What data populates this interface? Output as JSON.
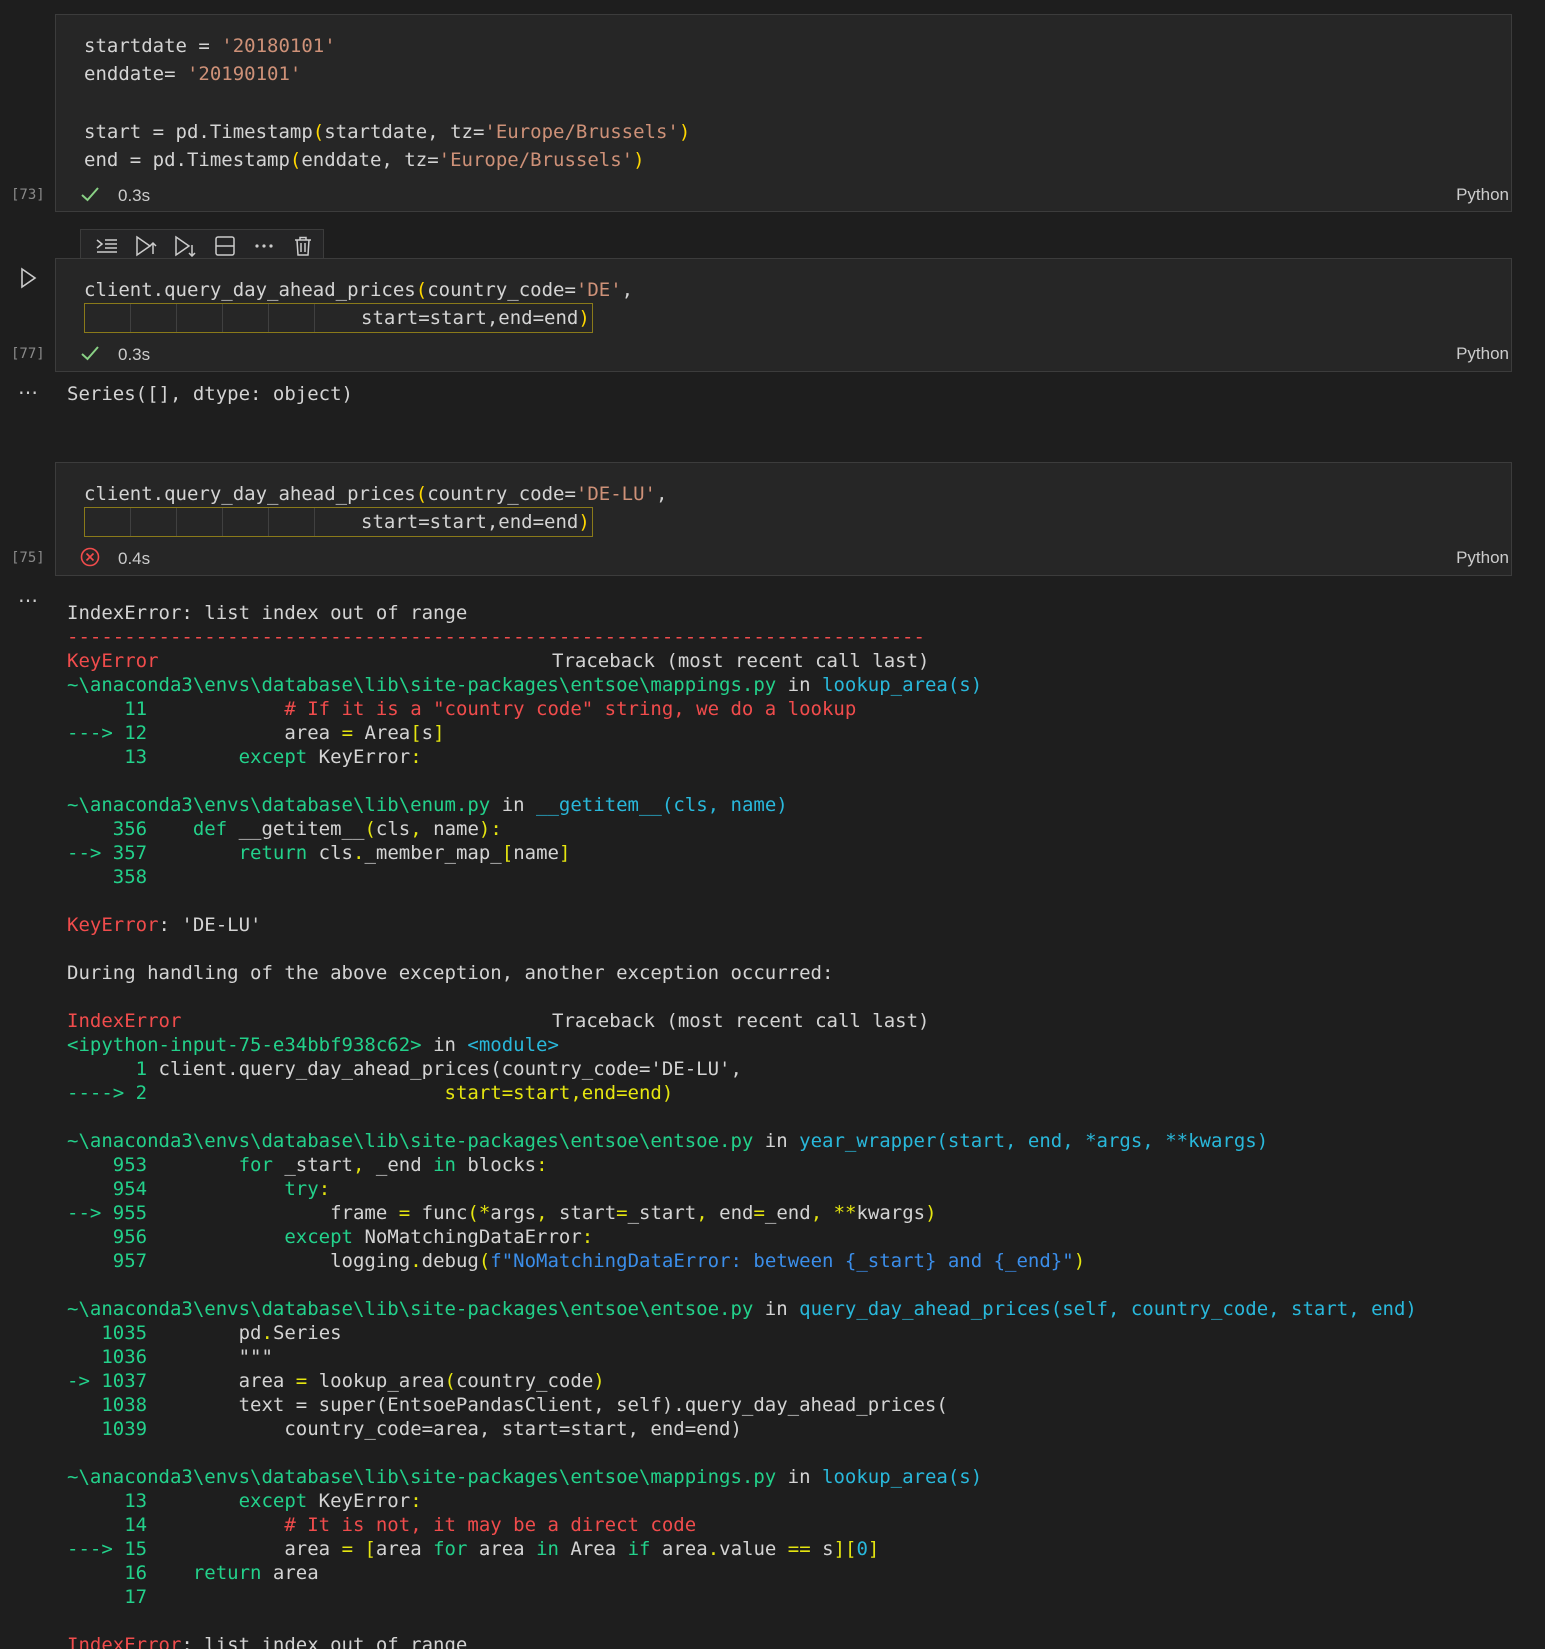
{
  "colors": {
    "background": "#1e1e1e",
    "cell_background": "#262626",
    "success_check": "#89d185",
    "error_icon": "#f14c4c",
    "string": "#ce9178",
    "bracket": "#ffd700",
    "ansi_red": "#f14c4c",
    "ansi_green": "#23d18b",
    "ansi_cyan": "#29b8db",
    "ansi_blue": "#3b8eea",
    "ansi_yellow": "#e5e510"
  },
  "toolbar": {
    "icons": [
      "execute-above-icon",
      "run-above-icon",
      "run-below-icon",
      "split-cell-icon",
      "more-actions-icon",
      "delete-cell-icon"
    ]
  },
  "cells": [
    {
      "exec_count": "[73]",
      "status": "success",
      "time": "0.3s",
      "language": "Python",
      "lines": [
        {
          "a": "startdate = ",
          "s": "'20180101'"
        },
        {
          "a": "enddate= ",
          "s": "'20190101'"
        },
        {
          "a": "start = pd.Timestamp",
          "p": "(",
          "b": "startdate, tz=",
          "s": "'Europe/Brussels'",
          "q": ")"
        },
        {
          "a": "end = pd.Timestamp",
          "p": "(",
          "b": "enddate, tz=",
          "s": "'Europe/Brussels'",
          "q": ")"
        }
      ]
    },
    {
      "exec_count": "[77]",
      "status": "success",
      "time": "0.3s",
      "language": "Python",
      "line1": {
        "a": "client.query_day_ahead_prices",
        "p": "(",
        "b": "country_code=",
        "s": "'DE'",
        "c": ","
      },
      "line2": {
        "a": "start=start,end=end",
        "q": ")"
      },
      "output": "Series([], dtype: object)"
    },
    {
      "exec_count": "[75]",
      "status": "error",
      "time": "0.4s",
      "language": "Python",
      "line1": {
        "a": "client.query_day_ahead_prices",
        "p": "(",
        "b": "country_code=",
        "s": "'DE-LU'",
        "c": ","
      },
      "line2": {
        "a": "start=start,end=end",
        "q": ")"
      }
    }
  ],
  "traceback": {
    "summary": "IndexError: list index out of range",
    "separator": "---------------------------------------------------------------------------",
    "l_keyerror_head": "KeyError",
    "l_keyerror_tb": "Traceback (most recent call last)",
    "f1_path": "~\\anaconda3\\envs\\database\\lib\\site-packages\\entsoe\\mappings.py",
    "in_word": "in",
    "f1_func": "lookup_area(s)",
    "f1_l11_no": "     11",
    "f1_l11_comment": "# If it is a \"country code\" string, we do a lookup",
    "f1_l12_no": "---> 12",
    "f1_l12_a": "area ",
    "f1_l12_b": "=",
    "f1_l12_c": " Area",
    "f1_l12_d": "[",
    "f1_l12_e": "s",
    "f1_l12_f": "]",
    "f1_l13_no": "     13",
    "f1_l13_kw": "except",
    "f1_l13_a": " KeyError",
    "f1_l13_b": ":",
    "f2_path": "~\\anaconda3\\envs\\database\\lib\\enum.py",
    "f2_func": "__getitem__(cls, name)",
    "f2_l356_no": "    356",
    "f2_l356_kw": "def",
    "f2_l356_a": " __getitem__",
    "f2_l356_b": "(",
    "f2_l356_c": "cls",
    "f2_l356_d": ",",
    "f2_l356_e": " name",
    "f2_l356_f": "):",
    "f2_l357_no": "--> 357",
    "f2_l357_kw": "return",
    "f2_l357_a": " cls",
    "f2_l357_b": ".",
    "f2_l357_c": "_member_map_",
    "f2_l357_d": "[",
    "f2_l357_e": "name",
    "f2_l357_f": "]",
    "f2_l358_no": "    358",
    "keyerror_msg_name": "KeyError",
    "keyerror_msg_rest": ": 'DE-LU'",
    "during": "During handling of the above exception, another exception occurred:",
    "l_indexerror_head": "IndexError",
    "l_indexerror_tb": "Traceback (most recent call last)",
    "f3_path": "<ipython-input-75-e34bbf938c62>",
    "f3_func": "<module>",
    "f3_l1_no": "      1",
    "f3_l1_code": " client.query_day_ahead_prices(country_code='DE-LU',",
    "f3_l2_no": "----> 2",
    "f3_l2_code": "start=start,end=end)",
    "f4_path": "~\\anaconda3\\envs\\database\\lib\\site-packages\\entsoe\\entsoe.py",
    "f4_func": "year_wrapper(start, end, *args, **kwargs)",
    "f4_l953_no": "    953",
    "f4_l953_kw": "for",
    "f4_l953_a": " _start",
    "f4_l953_b": ",",
    "f4_l953_c": " _end ",
    "f4_l953_d": "in",
    "f4_l953_e": " blocks",
    "f4_l953_f": ":",
    "f4_l954_no": "    954",
    "f4_l954_kw": "try",
    "f4_l954_b": ":",
    "f4_l955_no": "--> 955",
    "f4_l955_a": "frame ",
    "f4_l955_b": "=",
    "f4_l955_c": " func",
    "f4_l955_d": "(*",
    "f4_l955_e": "args",
    "f4_l955_f": ",",
    "f4_l955_g": " start",
    "f4_l955_h": "=",
    "f4_l955_i": "_start",
    "f4_l955_j": ",",
    "f4_l955_k": " end",
    "f4_l955_l": "=",
    "f4_l955_m": "_end",
    "f4_l955_n": ",",
    "f4_l955_o": " **",
    "f4_l955_p": "kwargs",
    "f4_l955_q": ")",
    "f4_l956_no": "    956",
    "f4_l956_kw": "except",
    "f4_l956_a": " NoMatchingDataError",
    "f4_l956_b": ":",
    "f4_l957_no": "    957",
    "f4_l957_a": "logging",
    "f4_l957_b": ".",
    "f4_l957_c": "debug",
    "f4_l957_d": "(",
    "f4_l957_e": "f\"NoMatchingDataError: between {_start} and {_end}\"",
    "f4_l957_f": ")",
    "f5_path": "~\\anaconda3\\envs\\database\\lib\\site-packages\\entsoe\\entsoe.py",
    "f5_func": "query_day_ahead_prices(self, country_code, start, end)",
    "f5_l1035_no": "   1035",
    "f5_l1035_a": "pd",
    "f5_l1035_b": ".",
    "f5_l1035_c": "Series",
    "f5_l1036_no": "   1036",
    "f5_l1036_a": "\"\"\"",
    "f5_l1037_no": "-> 1037",
    "f5_l1037_a": "area ",
    "f5_l1037_b": "=",
    "f5_l1037_c": " lookup_area",
    "f5_l1037_d": "(",
    "f5_l1037_e": "country_code",
    "f5_l1037_f": ")",
    "f5_l1038_no": "   1038",
    "f5_l1038_a": "text = super(EntsoePandasClient, self).query_day_ahead_prices(",
    "f5_l1039_no": "   1039",
    "f5_l1039_a": "country_code=area, start=start, end=end)",
    "f6_path": "~\\anaconda3\\envs\\database\\lib\\site-packages\\entsoe\\mappings.py",
    "f6_func": "lookup_area(s)",
    "f6_l13_no": "     13",
    "f6_l13_kw": "except",
    "f6_l13_a": " KeyError",
    "f6_l13_b": ":",
    "f6_l14_no": "     14",
    "f6_l14_comment": "# It is not, it may be a direct code",
    "f6_l15_no": "---> 15",
    "f6_l15_a": "area ",
    "f6_l15_b": "= [",
    "f6_l15_c": "area ",
    "f6_l15_d": "for",
    "f6_l15_e": " area ",
    "f6_l15_f": "in",
    "f6_l15_g": " Area ",
    "f6_l15_h": "if",
    "f6_l15_i": " area",
    "f6_l15_j": ".",
    "f6_l15_k": "value ",
    "f6_l15_l": "==",
    "f6_l15_m": " s",
    "f6_l15_n": "][",
    "f6_l15_o": "0",
    "f6_l15_p": "]",
    "f6_l16_no": "     16",
    "f6_l16_kw": "return",
    "f6_l16_a": " area",
    "f6_l17_no": "     17",
    "final_name": "IndexError",
    "final_rest": ": list index out of range"
  }
}
